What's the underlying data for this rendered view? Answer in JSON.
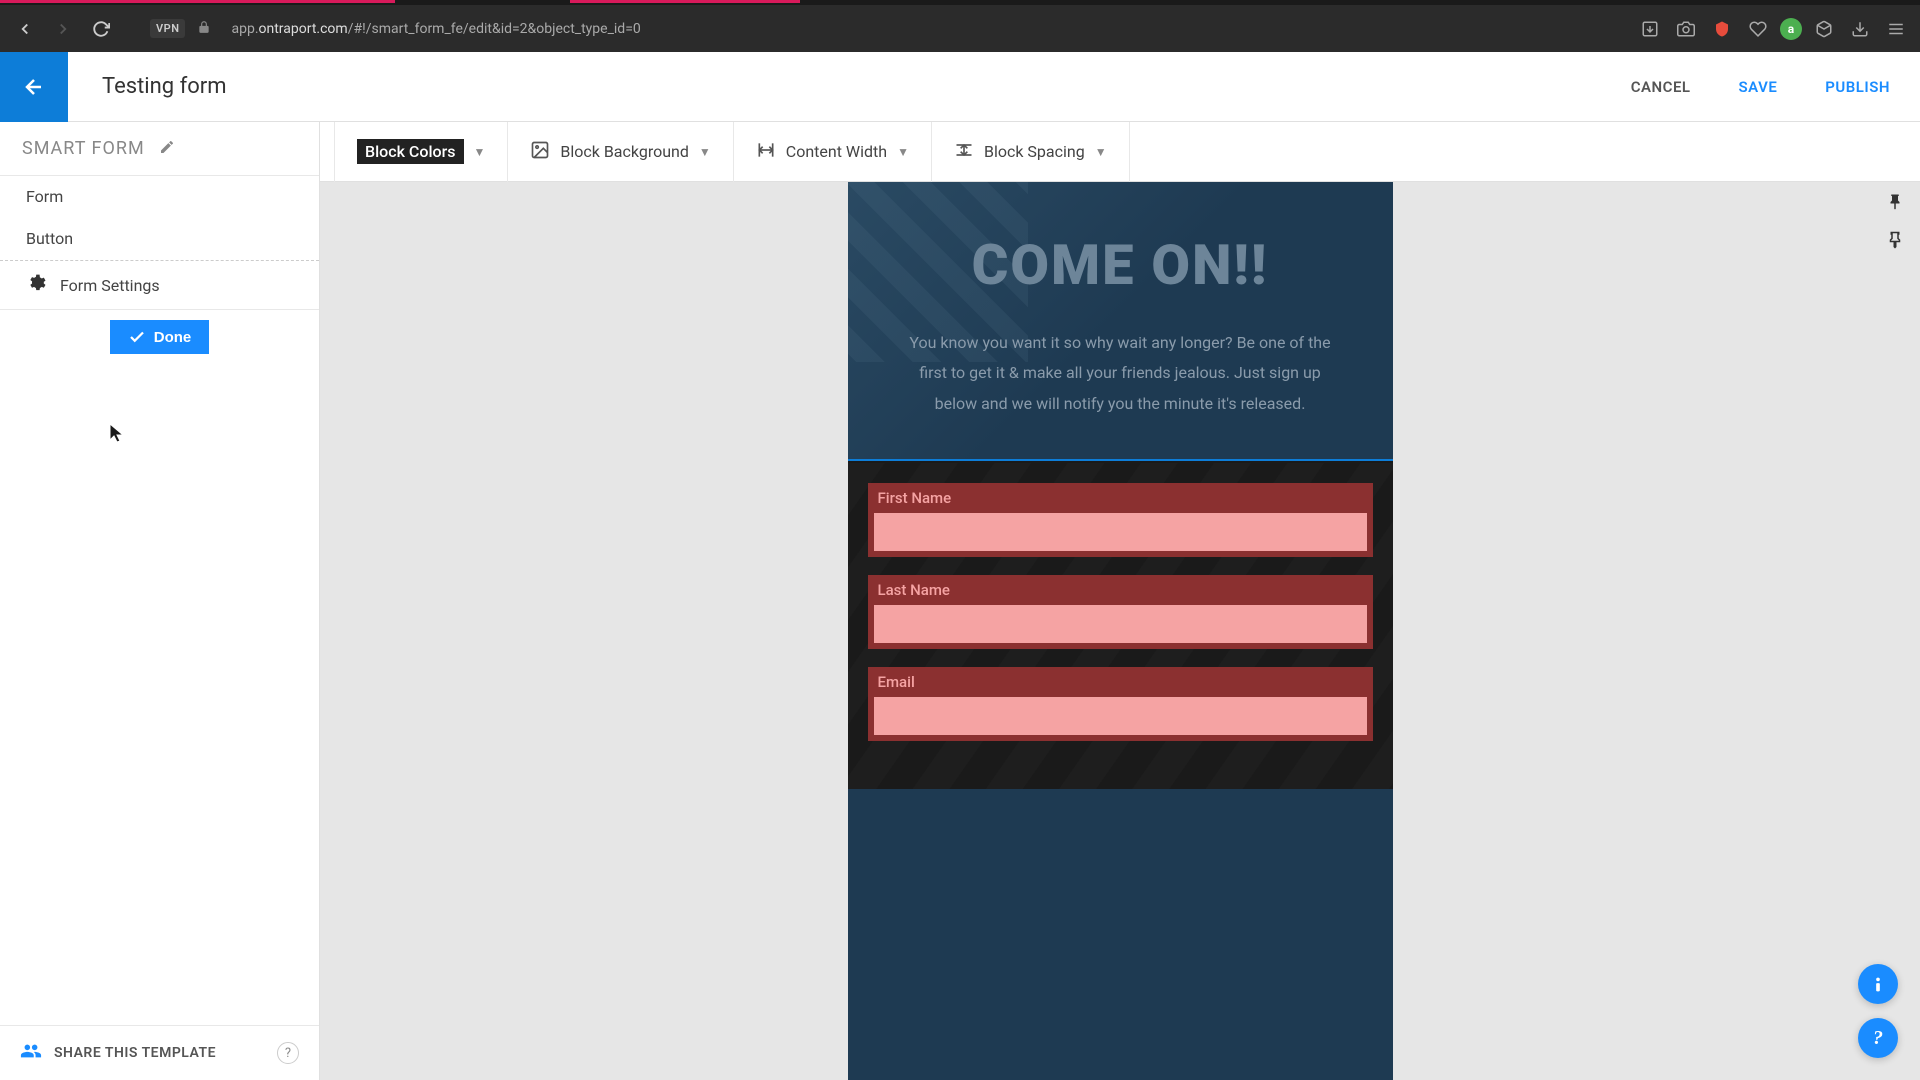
{
  "browser": {
    "url_prefix": "app.",
    "url_domain": "ontraport.com",
    "url_path": "/#!/smart_form_fe/edit&id=2&object_type_id=0",
    "vpn_label": "VPN"
  },
  "header": {
    "title": "Testing form",
    "cancel": "CANCEL",
    "save": "SAVE",
    "publish": "PUBLISH"
  },
  "sidebar": {
    "title": "SMART FORM",
    "items": [
      {
        "label": "Form"
      },
      {
        "label": "Button"
      }
    ],
    "settings_label": "Form Settings",
    "done_label": "Done",
    "share_label": "SHARE THIS TEMPLATE"
  },
  "toolbar": {
    "items": [
      {
        "label": "Block Colors",
        "active": true
      },
      {
        "label": "Block Background",
        "icon": "image"
      },
      {
        "label": "Content Width",
        "icon": "width"
      },
      {
        "label": "Block Spacing",
        "icon": "spacing"
      }
    ]
  },
  "preview": {
    "hero_title": "COME ON!!",
    "hero_desc": "You know you want it so why wait any longer? Be one of the first to get it & make all your friends jealous.  Just sign up below and we will notify you the minute it's released.",
    "fields": [
      {
        "label": "First Name"
      },
      {
        "label": "Last Name"
      },
      {
        "label": "Email"
      }
    ]
  },
  "colors": {
    "primary": "#1a8cff",
    "field_bg": "#f5a3a3",
    "field_border": "#8b3030"
  }
}
